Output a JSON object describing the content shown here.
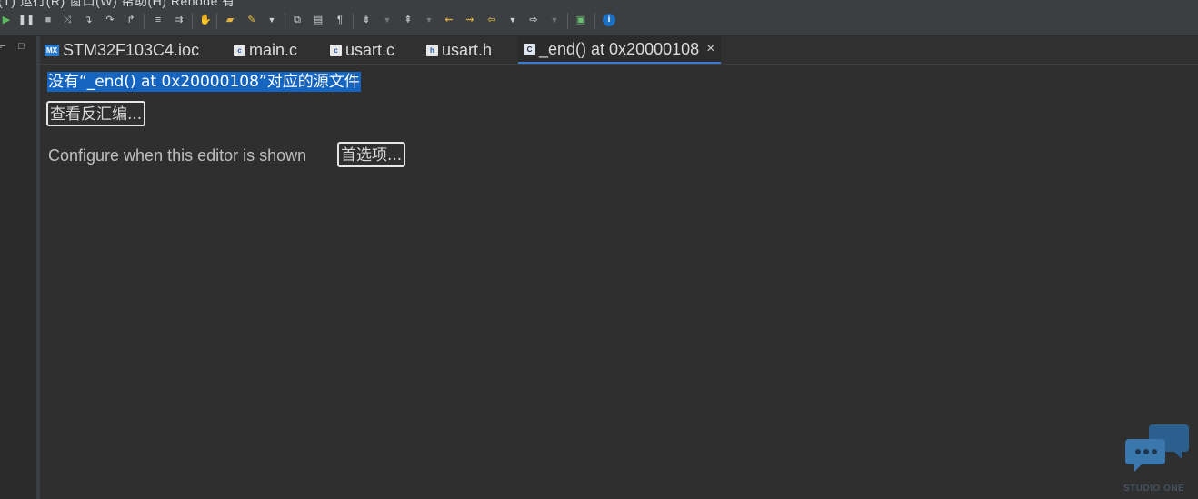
{
  "menubar": {
    "text": "(T)    运行(R)    窗口(W)    帮助(H)    Renode 有"
  },
  "toolbar": {
    "icons": [
      "resume-icon",
      "suspend-icon",
      "terminate-icon",
      "disconnect-icon",
      "step-into-icon",
      "step-over-icon",
      "step-return-icon",
      "drop-to-frame-icon",
      "use-step-filters-icon",
      "hand-icon",
      "open-file-icon",
      "pencil-icon",
      "dropdown-icon",
      "copy-icon",
      "document-icon",
      "pilcrow-icon",
      "annotation-icon",
      "prev-annotation-icon",
      "next-annotation-icon",
      "back-icon",
      "forward-icon",
      "last-edit-icon",
      "nav-back-icon",
      "nav-forward-icon",
      "external-tools-icon",
      "info-icon"
    ]
  },
  "tabs": [
    {
      "label": "STM32F103C4.ioc",
      "icon": "mx-icon"
    },
    {
      "label": "main.c",
      "icon": "c-file-icon"
    },
    {
      "label": "usart.c",
      "icon": "c-file-icon"
    },
    {
      "label": "usart.h",
      "icon": "h-file-icon"
    },
    {
      "label": "_end() at 0x20000108",
      "icon": "c-source-icon",
      "active": true
    }
  ],
  "editor": {
    "message": "没有“_end() at 0x20000108”对应的源文件",
    "view_disassembly_button": "查看反汇编...",
    "configure_text": "Configure when this editor is shown",
    "preferences_button": "首选项..."
  },
  "watermark": {
    "text": "STUDIO ONE"
  },
  "colors": {
    "background": "#2f2f2f",
    "selection": "#1565c0",
    "toolbar": "#3c3f41",
    "active_tab_underline": "#3a7bd5"
  }
}
